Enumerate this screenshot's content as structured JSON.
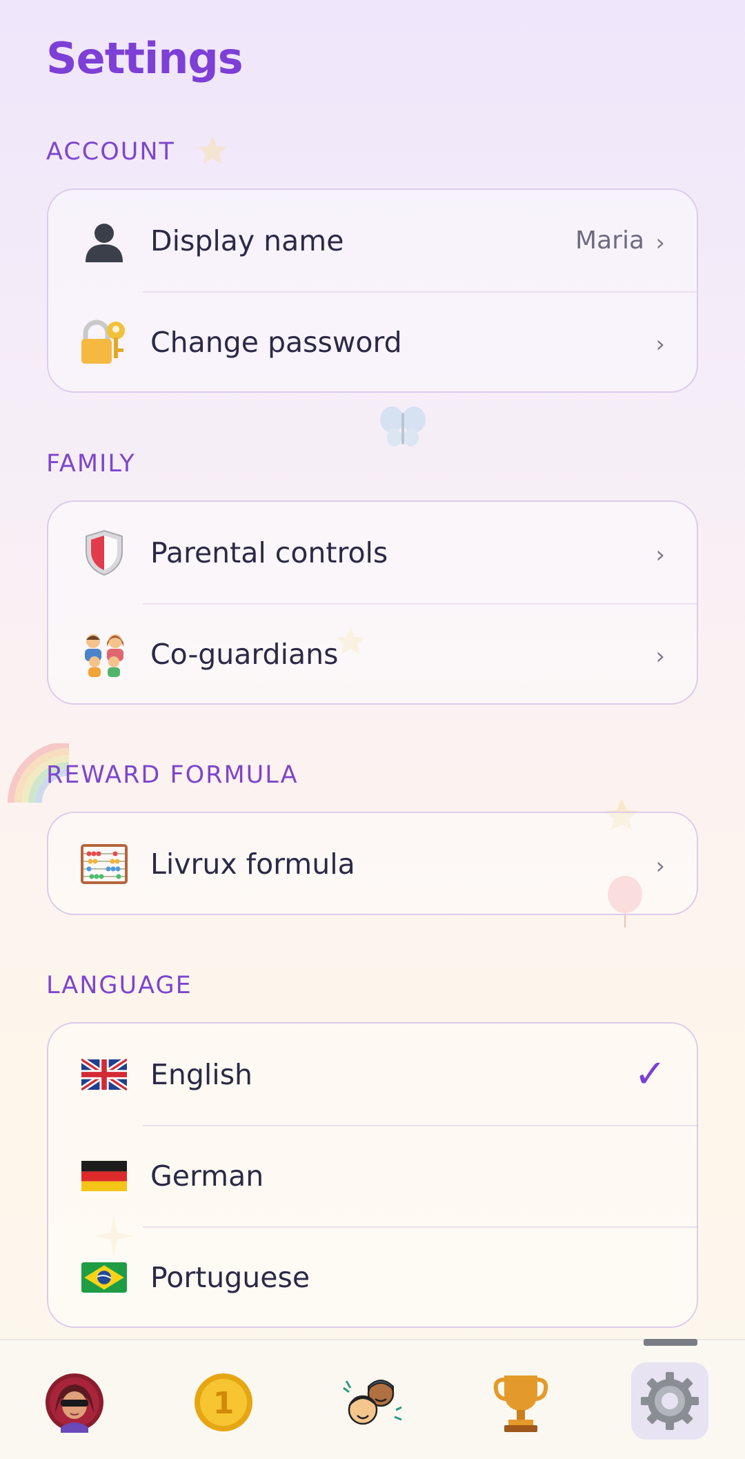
{
  "page": {
    "title": "Settings"
  },
  "sections": {
    "account": {
      "label": "ACCOUNT",
      "display_name": {
        "label": "Display name",
        "value": "Maria",
        "icon": "person-silhouette-icon"
      },
      "change_password": {
        "label": "Change password",
        "icon": "lock-key-icon"
      }
    },
    "family": {
      "label": "FAMILY",
      "parental_controls": {
        "label": "Parental controls",
        "icon": "shield-icon"
      },
      "co_guardians": {
        "label": "Co-guardians",
        "icon": "family-icon"
      }
    },
    "reward": {
      "label": "REWARD FORMULA",
      "livrux": {
        "label": "Livrux formula",
        "icon": "abacus-icon"
      }
    },
    "language": {
      "label": "LANGUAGE",
      "options": [
        {
          "label": "English",
          "icon": "uk-flag-icon",
          "selected": true
        },
        {
          "label": "German",
          "icon": "germany-flag-icon",
          "selected": false
        },
        {
          "label": "Portuguese",
          "icon": "brazil-flag-icon",
          "selected": false
        }
      ],
      "check": "✓"
    }
  },
  "chevron": "›",
  "tabbar": {
    "items": [
      {
        "name": "profile",
        "icon": "avatar-icon"
      },
      {
        "name": "coins",
        "icon": "coin-icon"
      },
      {
        "name": "community",
        "icon": "people-icon"
      },
      {
        "name": "achievements",
        "icon": "trophy-icon"
      },
      {
        "name": "settings",
        "icon": "gear-icon",
        "active": true
      }
    ]
  },
  "colors": {
    "accent": "#7d3fd6",
    "section": "#7d45cc",
    "border": "#dccbea"
  }
}
